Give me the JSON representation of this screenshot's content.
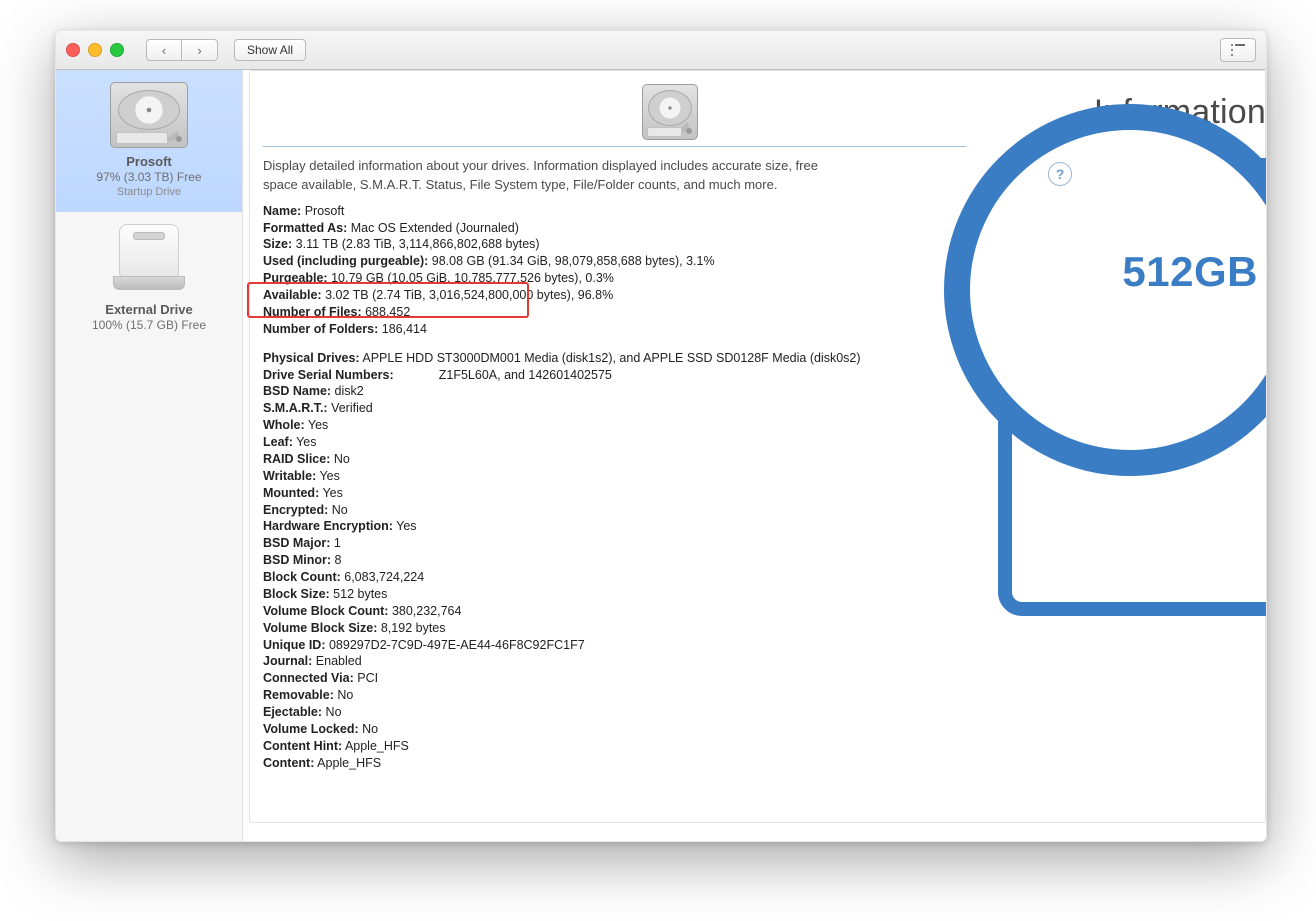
{
  "toolbar": {
    "back_glyph": "‹",
    "forward_glyph": "›",
    "show_all_label": "Show All"
  },
  "sidebar": {
    "drives": [
      {
        "name": "Prosoft",
        "free": "97% (3.03 TB) Free",
        "sub": "Startup Drive",
        "selected": true,
        "kind": "internal"
      },
      {
        "name": "External Drive",
        "free": "100% (15.7 GB) Free",
        "sub": "",
        "selected": false,
        "kind": "external"
      }
    ]
  },
  "page": {
    "title": "Information",
    "description": "Display detailed information about your drives. Information displayed includes accurate size, free space available, S.M.A.R.T. Status, File System type, File/Folder counts, and much more.",
    "help_glyph": "?"
  },
  "promo": {
    "ring_text": "512GB"
  },
  "info_basic": [
    {
      "k": "Name:",
      "v": " Prosoft"
    },
    {
      "k": "Formatted As:",
      "v": " Mac OS Extended (Journaled)"
    },
    {
      "k": "Size:",
      "v": " 3.11 TB (2.83 TiB, 3,114,866,802,688 bytes)"
    },
    {
      "k": "Used (including purgeable):",
      "v": " 98.08 GB (91.34 GiB, 98,079,858,688 bytes), 3.1%"
    },
    {
      "k": "Purgeable:",
      "v": " 10.79 GB (10.05 GiB, 10,785,777,526 bytes), 0.3%"
    },
    {
      "k": "Available:",
      "v": " 3.02 TB (2.74 TiB, 3,016,524,800,000 bytes), 96.8%"
    },
    {
      "k": "Number of Files:",
      "v": " 688,452"
    },
    {
      "k": "Number of Folders:",
      "v": " 186,414"
    }
  ],
  "info_hw": [
    {
      "k": "Physical Drives:",
      "v": " APPLE HDD ST3000DM001 Media (disk1s2), and APPLE SSD SD0128F Media (disk0s2)"
    },
    {
      "k": "Drive Serial Numbers:",
      "v": "             Z1F5L60A, and 142601402575"
    },
    {
      "k": "BSD Name:",
      "v": " disk2"
    },
    {
      "k": "S.M.A.R.T.:",
      "v": " Verified"
    },
    {
      "k": "Whole:",
      "v": " Yes"
    },
    {
      "k": "Leaf:",
      "v": " Yes"
    },
    {
      "k": "RAID Slice:",
      "v": " No"
    },
    {
      "k": "Writable:",
      "v": " Yes"
    },
    {
      "k": "Mounted:",
      "v": " Yes"
    },
    {
      "k": "Encrypted:",
      "v": " No"
    },
    {
      "k": "Hardware Encryption:",
      "v": " Yes"
    },
    {
      "k": "BSD Major:",
      "v": " 1"
    },
    {
      "k": "BSD Minor:",
      "v": " 8"
    },
    {
      "k": "Block Count:",
      "v": " 6,083,724,224"
    },
    {
      "k": "Block Size:",
      "v": " 512 bytes"
    },
    {
      "k": "Volume Block Count:",
      "v": " 380,232,764"
    },
    {
      "k": "Volume Block Size:",
      "v": " 8,192 bytes"
    },
    {
      "k": "Unique ID:",
      "v": " 089297D2-7C9D-497E-AE44-46F8C92FC1F7"
    },
    {
      "k": "Journal:",
      "v": " Enabled"
    },
    {
      "k": "Connected Via:",
      "v": " PCI"
    },
    {
      "k": "Removable:",
      "v": " No"
    },
    {
      "k": "Ejectable:",
      "v": " No"
    },
    {
      "k": "Volume Locked:",
      "v": " No"
    },
    {
      "k": "Content Hint:",
      "v": " Apple_HFS"
    },
    {
      "k": "Content:",
      "v": " Apple_HFS"
    }
  ]
}
